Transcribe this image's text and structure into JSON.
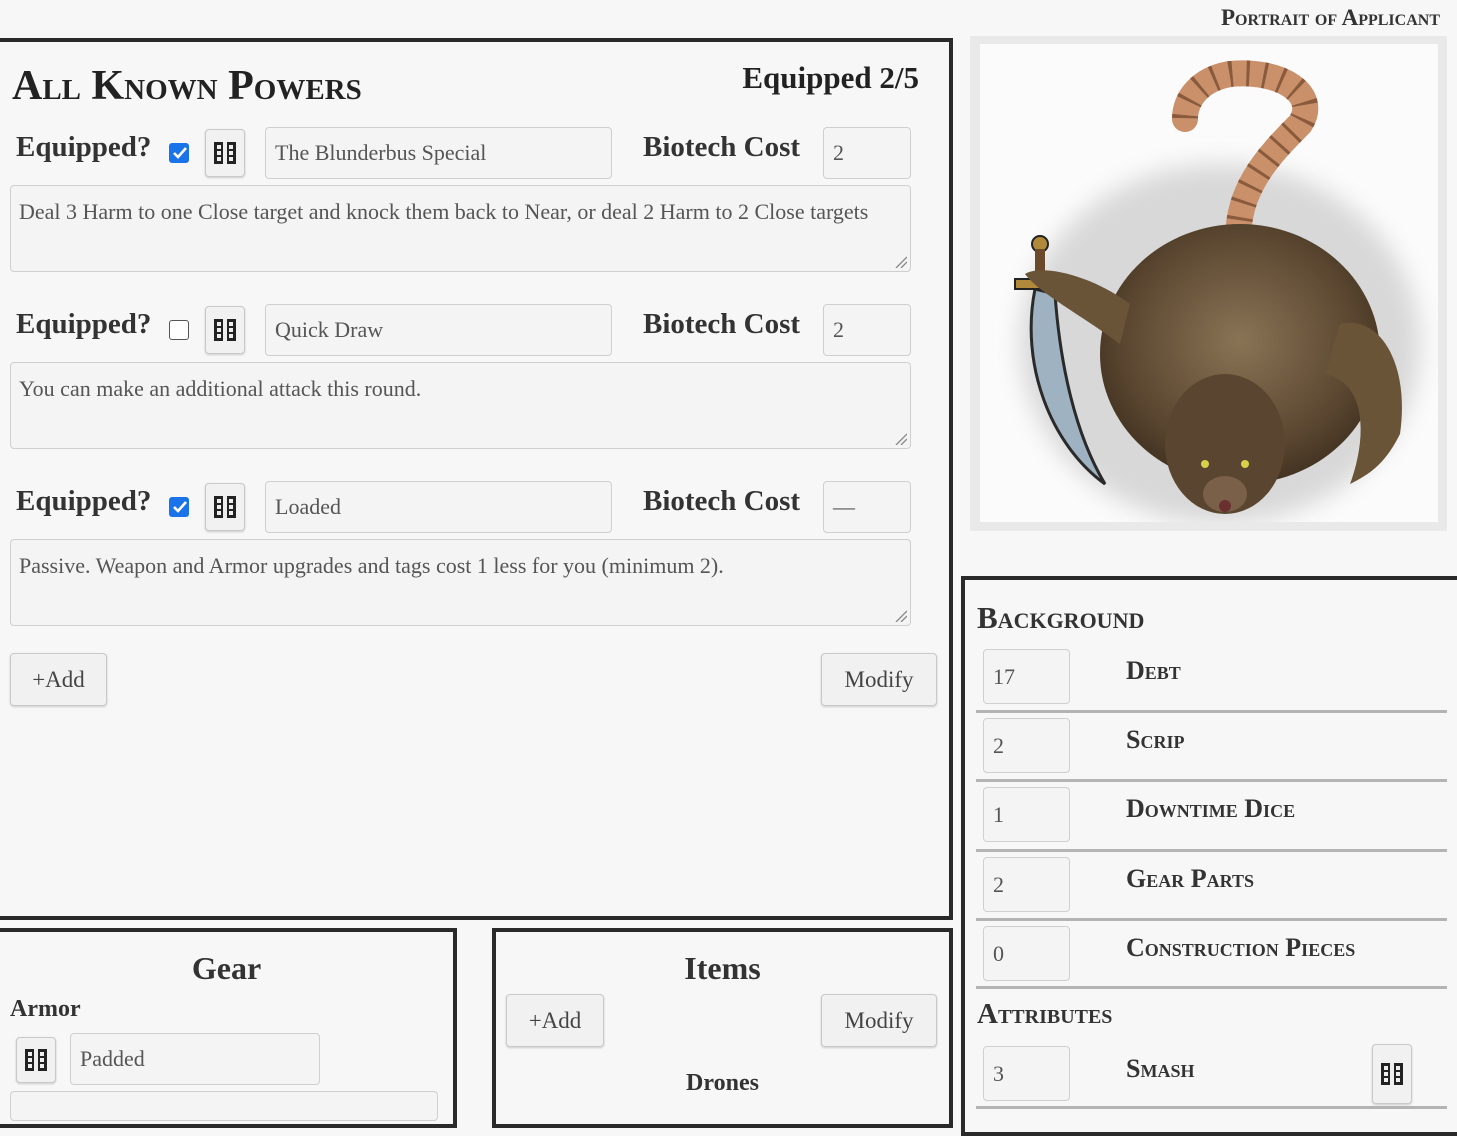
{
  "portrait": {
    "title": "Portrait of Applicant",
    "image_alt": "rat-creature-with-dagger"
  },
  "powers": {
    "title": "All Known Powers",
    "equipped_count": "Equipped 2/5",
    "equipped_label": "Equipped?",
    "cost_label": "Biotech Cost",
    "items": [
      {
        "equipped": true,
        "name": "The Blunderbus Special",
        "cost": "2",
        "description": "Deal 3 Harm to one Close target and knock them back to Near, or deal 2 Harm to 2 Close targets"
      },
      {
        "equipped": false,
        "name": "Quick Draw",
        "cost": "2",
        "description": "You can make an additional attack this round."
      },
      {
        "equipped": true,
        "name": "Loaded",
        "cost": "—",
        "description": "Passive. Weapon and Armor upgrades and tags cost 1 less for you (minimum 2)."
      }
    ],
    "add_label": "+Add",
    "modify_label": "Modify"
  },
  "background": {
    "title": "Background",
    "rows": [
      {
        "value": "17",
        "label": "Debt"
      },
      {
        "value": "2",
        "label": "Scrip"
      },
      {
        "value": "1",
        "label": "Downtime Dice"
      },
      {
        "value": "2",
        "label": "Gear Parts"
      },
      {
        "value": "0",
        "label": "Construction Pieces"
      }
    ],
    "attributes_title": "Attributes",
    "attributes": [
      {
        "value": "3",
        "label": "Smash"
      }
    ]
  },
  "gear": {
    "title": "Gear",
    "armor_label": "Armor",
    "armor_value": "Padded"
  },
  "items": {
    "title": "Items",
    "add_label": "+Add",
    "modify_label": "Modify",
    "drones_label": "Drones"
  },
  "colors": {
    "checkbox_checked": "#1a73e8",
    "panel_border": "#2a2a2a"
  },
  "icons": {
    "dice": "film-strip-dice-icon",
    "resize": "resize-grip-icon"
  }
}
